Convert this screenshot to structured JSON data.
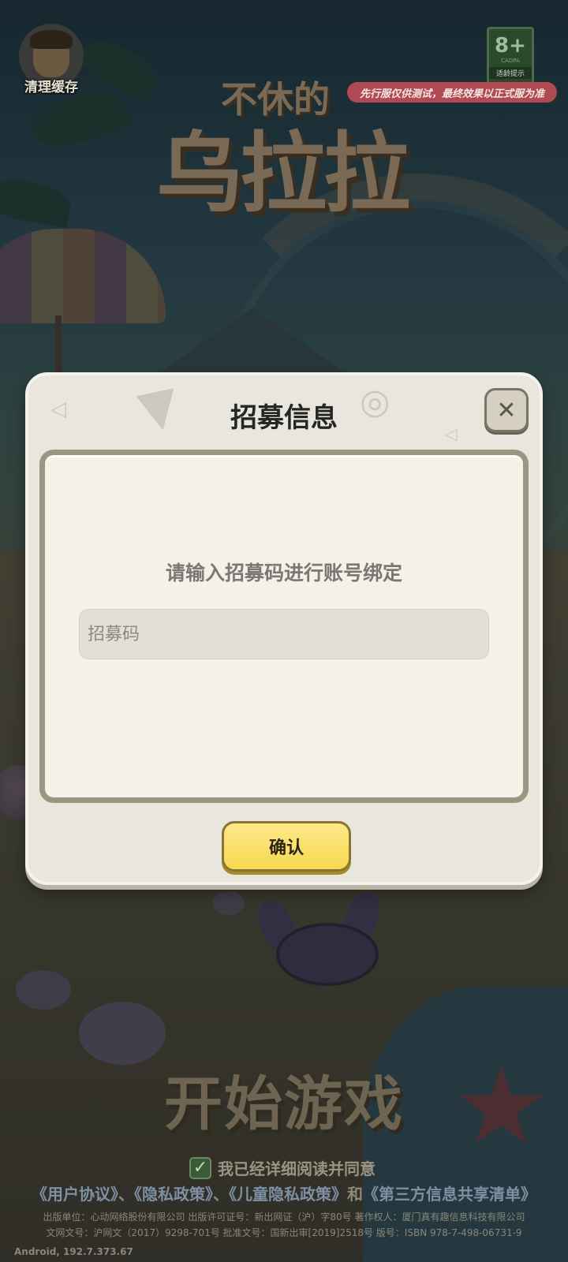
{
  "top": {
    "clear_cache_label": "清理缓存",
    "age_rating": "8+",
    "age_rating_sub": "CADPA",
    "age_rating_tip": "适龄提示",
    "test_banner": "先行服仅供测试，最终效果以正式服为准"
  },
  "logo": {
    "line1": "不休的",
    "line2": "乌拉拉"
  },
  "dialog": {
    "title": "招募信息",
    "prompt": "请输入招募码进行账号绑定",
    "input_placeholder": "招募码",
    "input_value": "",
    "confirm_label": "确认",
    "close_icon": "close-icon"
  },
  "bottom": {
    "start_game": "开始游戏",
    "agree_text": "我已经详细阅读并同意",
    "links": [
      "《用户协议》",
      "《隐私政策》",
      "《儿童隐私政策》",
      "《第三方信息共享清单》"
    ],
    "sep1": "、",
    "sep2": "、",
    "and": "和",
    "publisher_line": "出版单位：心动网络股份有限公司  出版许可证号：新出网证（沪）字80号  著作权人：厦门真有趣信息科技有限公司",
    "license_line": "文网文号：沪网文（2017）9298-701号  批准文号：国新出审[2019]2518号  版号：ISBN 978-7-498-06731-9",
    "version": "Android, 192.7.373.67"
  },
  "colors": {
    "dialog_bg": "#e9e6dd",
    "panel_bg": "#f6f1e7",
    "confirm_yellow": "#f7d850",
    "test_banner_red": "#b04a52"
  }
}
